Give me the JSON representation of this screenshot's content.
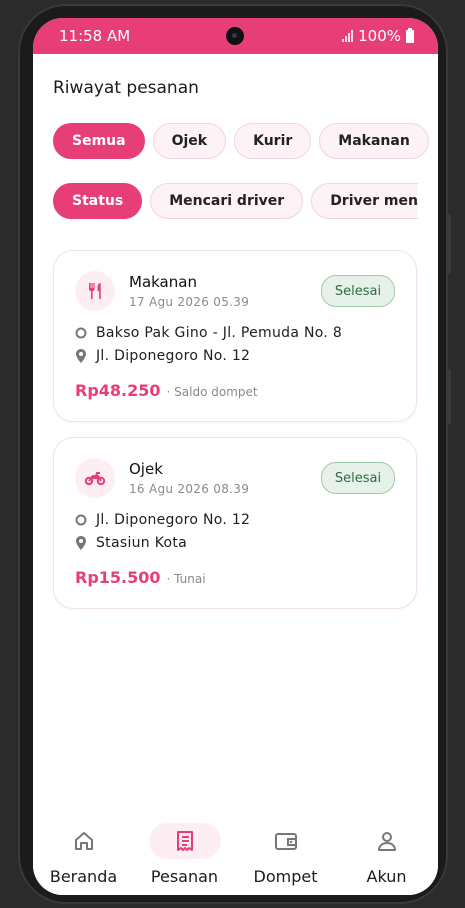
{
  "status_bar": {
    "time": "11:58 AM",
    "battery": "100%"
  },
  "page": {
    "title": "Riwayat pesanan"
  },
  "filters": {
    "service": [
      {
        "label": "Semua",
        "active": true
      },
      {
        "label": "Ojek",
        "active": false
      },
      {
        "label": "Kurir",
        "active": false
      },
      {
        "label": "Makanan",
        "active": false
      }
    ],
    "status": [
      {
        "label": "Status",
        "active": true
      },
      {
        "label": "Mencari driver",
        "active": false
      },
      {
        "label": "Driver menuju lo",
        "active": false
      }
    ]
  },
  "orders": [
    {
      "service": "Makanan",
      "icon": "cutlery-icon",
      "date": "17 Agu 2026 05.39",
      "status": "Selesai",
      "pickup": "Bakso Pak Gino - Jl. Pemuda No. 8",
      "dropoff": "Jl. Diponegoro No. 12",
      "price": "Rp48.250",
      "payment": "· Saldo dompet"
    },
    {
      "service": "Ojek",
      "icon": "motorbike-icon",
      "date": "16 Agu 2026 08.39",
      "status": "Selesai",
      "pickup": "Jl. Diponegoro No. 12",
      "dropoff": "Stasiun Kota",
      "price": "Rp15.500",
      "payment": "· Tunai"
    }
  ],
  "bottom_nav": [
    {
      "label": "Beranda",
      "icon": "home-icon",
      "active": false
    },
    {
      "label": "Pesanan",
      "icon": "receipt-icon",
      "active": true
    },
    {
      "label": "Dompet",
      "icon": "wallet-icon",
      "active": false
    },
    {
      "label": "Akun",
      "icon": "person-icon",
      "active": false
    }
  ],
  "colors": {
    "accent": "#e83e78",
    "success_bg": "#e6f1e8",
    "success_text": "#2f6c43"
  }
}
